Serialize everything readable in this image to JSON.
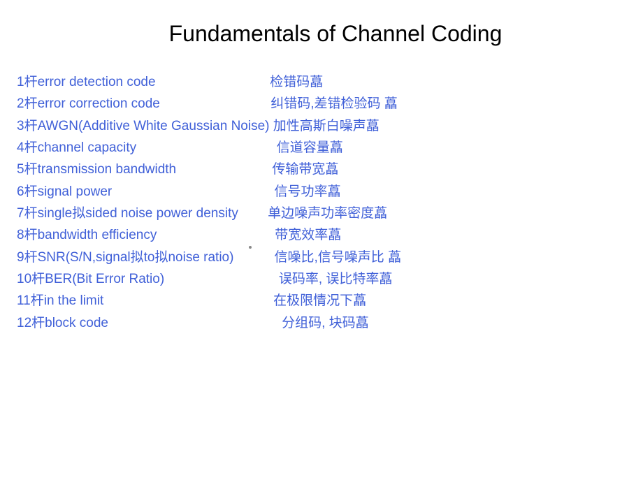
{
  "title": "Fundamentals of Channel Coding",
  "rows": [
    {
      "num": "1杆",
      "en": " error detection code",
      "pad": "                               ",
      "cn": "检错码藠"
    },
    {
      "num": "2杆",
      "en": " error correction code",
      "pad": "                              ",
      "cn": "纠错码,差错检验码     藠"
    },
    {
      "num": "3杆",
      "en": " AWGN(Additive White Gaussian Noise)",
      "pad": " ",
      "cn": "加性高斯白噪声藠"
    },
    {
      "num": "4杆",
      "en": " channel capacity",
      "pad": "                                      ",
      "cn": " 信道容量藠"
    },
    {
      "num": "5杆",
      "en": " transmission bandwidth",
      "pad": "                          ",
      "cn": "传输带宽藠"
    },
    {
      "num": "6杆",
      "en": " signal power",
      "pad": "                                            ",
      "cn": " 信号功率藠"
    },
    {
      "num": "7杆",
      "en": " single拟sided noise power density",
      "pad": "        ",
      "cn": " 单边噪声功率密度藠"
    },
    {
      "num": "8杆",
      "en": " bandwidth efficiency",
      "pad": "                                ",
      "cn": " 带宽效率藠"
    },
    {
      "num": "9杆",
      "en": " SNR(S/N,signal拟to拟noise ratio)",
      "pad": "           ",
      "cn": " 信噪比,信号噪声比 藠"
    },
    {
      "num": "10杆",
      "en": " BER(Bit Error Ratio)",
      "pad": "                               ",
      "cn": " 误码率, 误比特率藠"
    },
    {
      "num": "11杆",
      "en": " in the limit",
      "pad": "                                              ",
      "cn": " 在极限情况下藠"
    },
    {
      "num": "12杆",
      "en": " block code",
      "pad": "                                               ",
      "cn": "  分组码, 块码藠"
    }
  ]
}
